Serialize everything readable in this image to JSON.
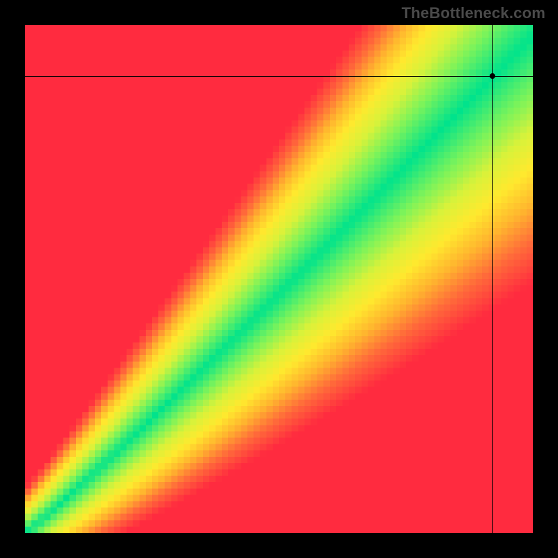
{
  "watermark": "TheBottleneck.com",
  "chart_data": {
    "type": "heatmap",
    "title": "",
    "xlabel": "",
    "ylabel": "",
    "xlim": [
      0,
      100
    ],
    "ylim": [
      0,
      100
    ],
    "grid_size": 80,
    "band": {
      "description": "diagonal optimal band (green) from bottom-left to top-right; value falls off with distance from slightly super-linear curve",
      "curve_exponent": 1.06,
      "curve_gain": 0.98,
      "half_width_frac_start": 0.018,
      "half_width_frac_end": 0.11
    },
    "colorscale": [
      {
        "t": 0.0,
        "hex": "#00e38c"
      },
      {
        "t": 0.18,
        "hex": "#7cf35a"
      },
      {
        "t": 0.34,
        "hex": "#d8f23a"
      },
      {
        "t": 0.5,
        "hex": "#ffe92e"
      },
      {
        "t": 0.66,
        "hex": "#ffb52e"
      },
      {
        "t": 0.82,
        "hex": "#ff6a3a"
      },
      {
        "t": 1.0,
        "hex": "#ff2b3f"
      }
    ],
    "crosshair": {
      "x": 92,
      "y": 90
    },
    "marker": {
      "x": 92,
      "y": 90
    }
  }
}
